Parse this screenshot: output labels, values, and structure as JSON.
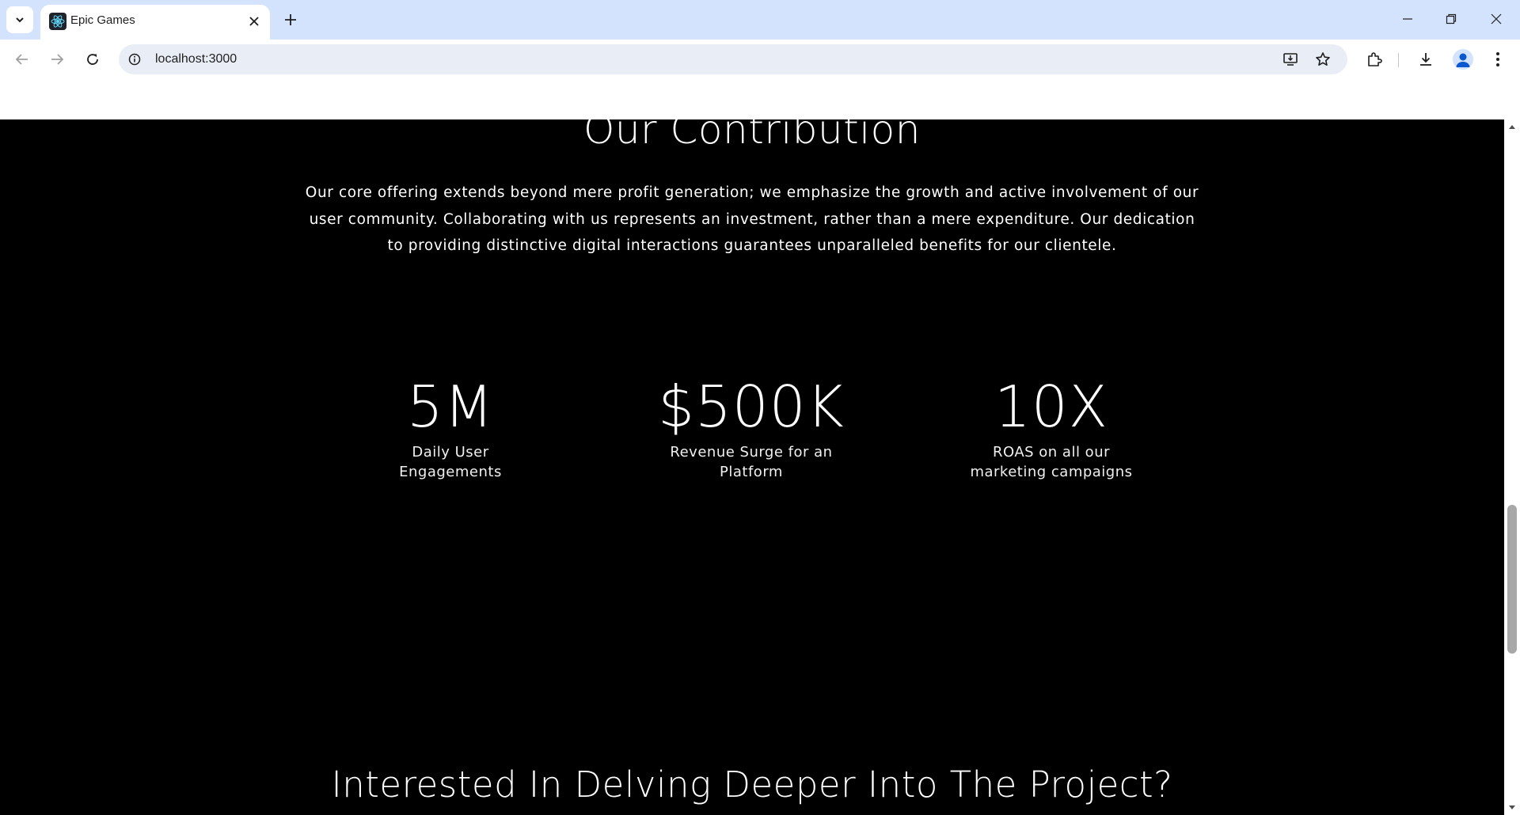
{
  "browser": {
    "tab_title": "Epic Games",
    "url": "localhost:3000"
  },
  "page": {
    "contribution_heading": "Our Contribution",
    "contribution_text": "Our core offering extends beyond mere profit generation; we emphasize the growth and active involvement of our user community. Collaborating with us represents an investment, rather than a mere expenditure. Our dedication to providing distinctive digital interactions guarantees unparalleled benefits for our clientele.",
    "stats": [
      {
        "value": "5M",
        "label": "Daily User Engagements"
      },
      {
        "value": "$500K",
        "label": "Revenue Surge for an Platform"
      },
      {
        "value": "10X",
        "label": "ROAS on all our marketing campaigns"
      }
    ],
    "project_heading": "Interested In Delving Deeper Into The Project?"
  },
  "colors": {
    "tabstrip": "#d3e3fd",
    "omnibox": "#e9eef6",
    "page_background": "#000000",
    "text": "#ffffff"
  }
}
